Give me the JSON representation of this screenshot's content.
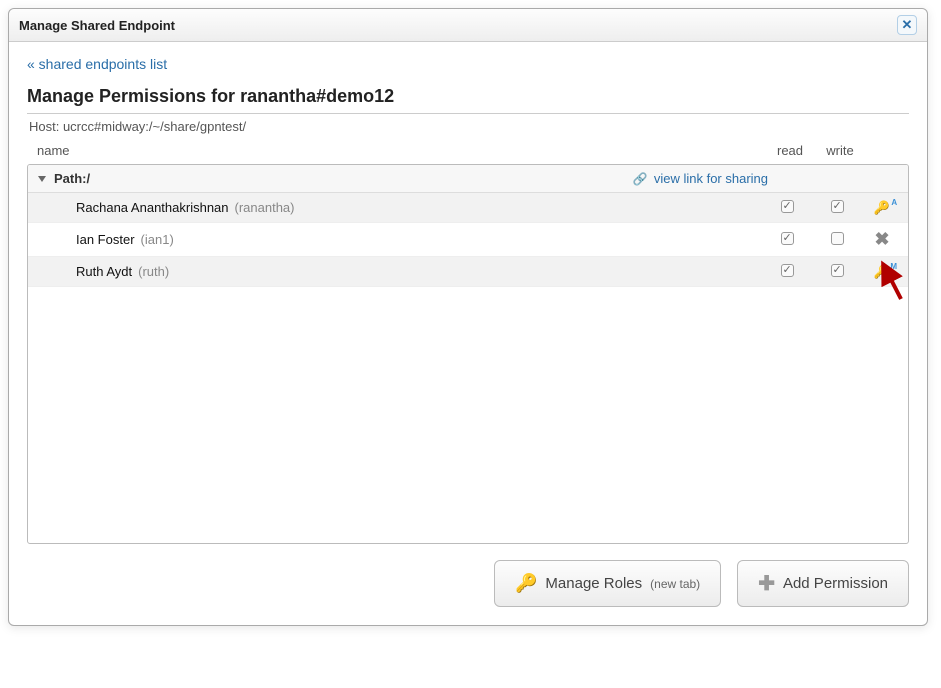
{
  "dialog": {
    "title": "Manage Shared Endpoint"
  },
  "backlink": "« shared endpoints list",
  "permissions": {
    "title": "Manage Permissions for ranantha#demo12",
    "host": "Host: ucrcc#midway:/~/share/gpntest/"
  },
  "columns": {
    "name": "name",
    "read": "read",
    "write": "write"
  },
  "path": {
    "label": "Path:/",
    "viewlink": "view link for sharing"
  },
  "users": [
    {
      "name": "Rachana Ananthakrishnan",
      "id": "(ranantha)",
      "read": true,
      "write": true,
      "action": "key-a"
    },
    {
      "name": "Ian Foster",
      "id": "(ian1)",
      "read": true,
      "write": false,
      "action": "x"
    },
    {
      "name": "Ruth Aydt",
      "id": "(ruth)",
      "read": true,
      "write": true,
      "action": "key-m"
    }
  ],
  "buttons": {
    "manage_roles": "Manage Roles",
    "manage_roles_sub": "(new tab)",
    "add_permission": "Add Permission"
  }
}
